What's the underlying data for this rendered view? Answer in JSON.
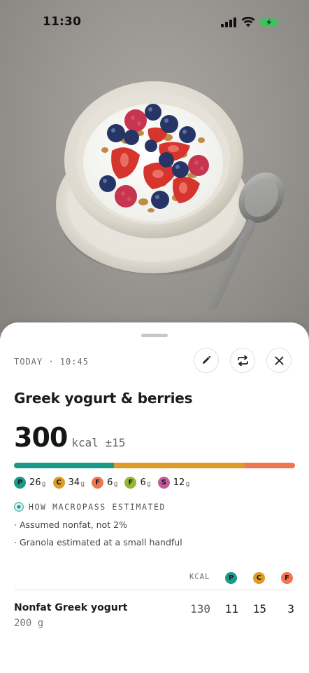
{
  "status_bar": {
    "time": "11:30"
  },
  "entry": {
    "meta": "TODAY · 10:45",
    "title": "Greek yogurt & berries",
    "kcal": "300",
    "kcal_unit": "kcal ±15"
  },
  "calorie_bar": [
    {
      "name": "protein",
      "fraction": 0.355,
      "color": "#1b9a8a"
    },
    {
      "name": "carbs",
      "fraction": 0.465,
      "color": "#dd9a26"
    },
    {
      "name": "fat",
      "fraction": 0.18,
      "color": "#ee7650"
    }
  ],
  "macros": [
    {
      "key": "protein",
      "letter": "P",
      "value": "26",
      "unit": "g",
      "color": "#1b9a8a"
    },
    {
      "key": "carbs",
      "letter": "C",
      "value": "34",
      "unit": "g",
      "color": "#dd9a26"
    },
    {
      "key": "fat",
      "letter": "F",
      "value": "6",
      "unit": "g",
      "color": "#ee7650"
    },
    {
      "key": "fiber",
      "letter": "F",
      "value": "6",
      "unit": "g",
      "color": "#93b738"
    },
    {
      "key": "sugar",
      "letter": "S",
      "value": "12",
      "unit": "g",
      "color": "#c45a9b"
    }
  ],
  "estimation": {
    "label": "HOW MACROPASS ESTIMATED",
    "notes": [
      "· Assumed nonfat, not 2%",
      "· Granola estimated at a small handful"
    ]
  },
  "table": {
    "headers": [
      "KCAL",
      "P",
      "C",
      "F"
    ],
    "rows": [
      {
        "name": "Nonfat Greek yogurt",
        "qty": "200 g",
        "kcal": "130",
        "p": "11",
        "c": "15",
        "f": "3"
      }
    ]
  },
  "icons": [
    "signal-icon",
    "wifi-icon",
    "battery-charging-icon",
    "pencil-icon",
    "swap-icon",
    "close-icon",
    "estimate-icon"
  ],
  "colors": {
    "protein": "#1b9a8a",
    "carbs": "#dd9a26",
    "fat": "#ee7650",
    "fiber": "#93b738",
    "sugar": "#c45a9b",
    "battery": "#35c759"
  }
}
